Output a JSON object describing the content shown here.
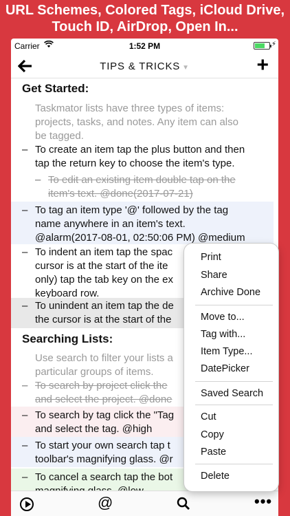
{
  "banner": {
    "line1": "URL Schemes, Colored Tags, iCloud Drive,",
    "line2": "Touch ID, AirDrop, Open In..."
  },
  "status": {
    "carrier": "Carrier",
    "time": "1:52 PM",
    "battery_level": 0.65
  },
  "nav": {
    "back_icon": "back-arrow-icon",
    "title": "TIPS & TRICKS",
    "add_icon": "plus-icon"
  },
  "content": {
    "get_started": "Get Started:",
    "get_started_note": [
      "Taskmator lists have three types of items:",
      "projects, tasks, and notes. Any item can also",
      "be tagged."
    ],
    "task_create": [
      "To create an item tap the plus button and then",
      "tap the return key to choose the item's type."
    ],
    "task_edit": [
      "To edit an existing item double tap on the",
      "item's text. @done(2017-07-21)"
    ],
    "task_tag": [
      "To tag an item type '@' followed by the tag",
      "name anywhere in an item's text.",
      "@alarm(2017-08-01, 02:50:06 PM) @medium"
    ],
    "task_indent": [
      "To indent an item tap the spac",
      "cursor is at the start of the ite",
      "only) tap the tab key on the ex",
      "keyboard row."
    ],
    "task_unindent": [
      "To unindent an item tap the de",
      "the cursor is at the start of the"
    ],
    "searching": "Searching Lists:",
    "searching_note": [
      "Use search to filter your lists a",
      "particular groups of items."
    ],
    "task_search_project": [
      "To search by project click the",
      "and select the project. @done"
    ],
    "task_search_tag": [
      "To search by tag click the \"Tag",
      "and select the tag. @high"
    ],
    "task_search_own": [
      "To start your own search tap t",
      "toolbar's magnifying glass. @r"
    ],
    "task_search_cancel": [
      "To cancel a search tap the bot",
      "magnifying glass. @low"
    ]
  },
  "menu": {
    "print": "Print",
    "share": "Share",
    "archive_done": "Archive Done",
    "move_to": "Move to...",
    "tag_with": "Tag with...",
    "item_type": "Item Type...",
    "date_picker": "DatePicker",
    "saved_search": "Saved Search",
    "cut": "Cut",
    "copy": "Copy",
    "paste": "Paste",
    "delete": "Delete"
  },
  "toolbar": {
    "play_icon": "play-circle-icon",
    "at_glyph": "@",
    "search_icon": "magnifying-glass-icon",
    "more_glyph": "•••"
  },
  "colors": {
    "banner_bg": "#d8383f",
    "blue_row": "#eef2fb",
    "gray_row": "#e8e8e8",
    "pink_row": "#fbeef0",
    "green_row": "#eaf7e7",
    "battery_green": "#4cd964"
  }
}
